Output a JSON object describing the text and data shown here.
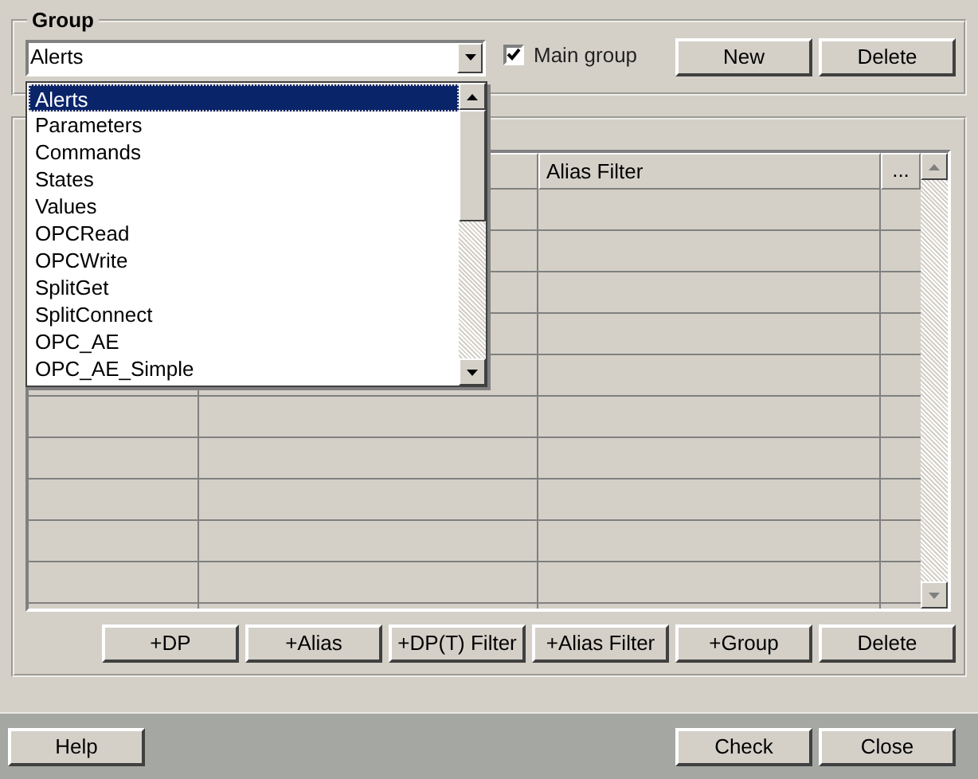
{
  "group": {
    "legend": "Group",
    "combo": {
      "value": "Alerts",
      "expanded": true
    },
    "main_group": {
      "label": "Main group",
      "checked": true
    },
    "buttons": [
      "New",
      "Delete"
    ]
  },
  "dropdown": {
    "items": [
      {
        "label": "Alerts",
        "selected": true
      },
      {
        "label": "Parameters",
        "selected": false
      },
      {
        "label": "Commands",
        "selected": false
      },
      {
        "label": "States",
        "selected": false
      },
      {
        "label": "Values",
        "selected": false
      },
      {
        "label": "OPCRead",
        "selected": false
      },
      {
        "label": "OPCWrite",
        "selected": false
      },
      {
        "label": "SplitGet",
        "selected": false
      },
      {
        "label": "SplitConnect",
        "selected": false
      },
      {
        "label": "OPC_AE",
        "selected": false
      },
      {
        "label": "OPC_AE_Simple",
        "selected": false
      }
    ]
  },
  "table": {
    "column_3": "Alias Filter",
    "column_4": "..."
  },
  "action_buttons": [
    "+DP",
    "+Alias",
    "+DP(T) Filter",
    "+Alias Filter",
    "+Group",
    "Delete"
  ],
  "footer": {
    "left_buttons": [
      "Help"
    ],
    "right_buttons": [
      "Check",
      "Close"
    ]
  }
}
